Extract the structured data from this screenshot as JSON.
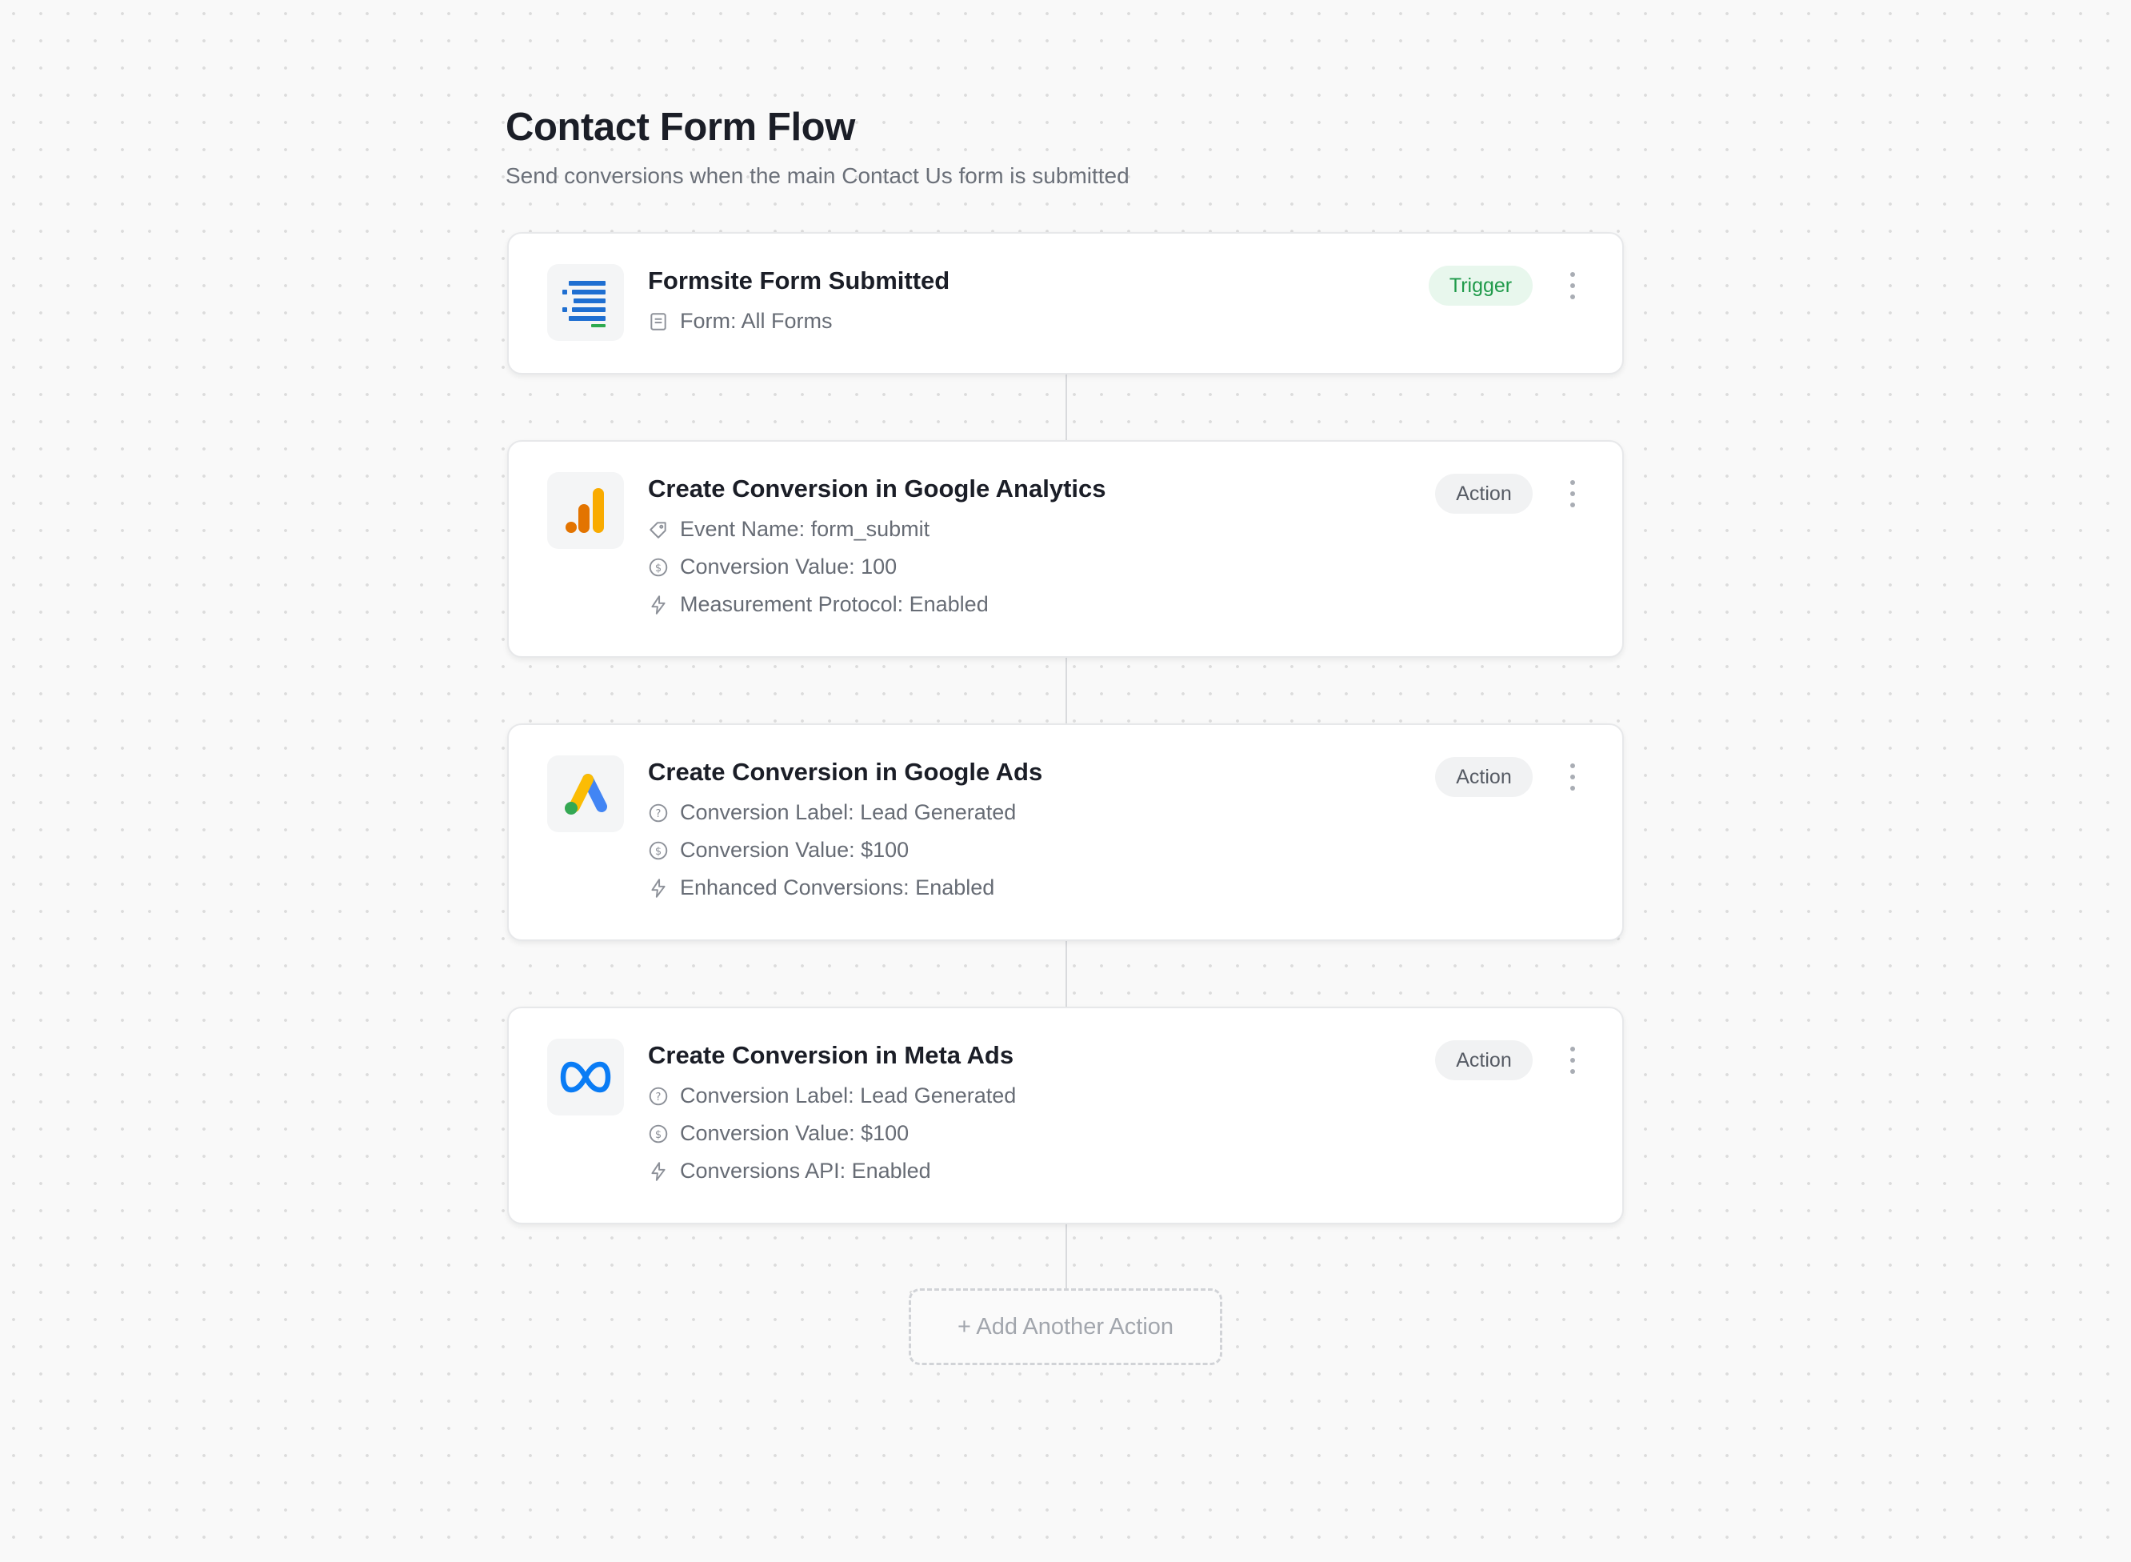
{
  "header": {
    "title": "Contact Form Flow",
    "subtitle": "Send conversions when the main Contact Us form is submitted"
  },
  "steps": [
    {
      "app": "Formsite",
      "title": "Formsite Form Submitted",
      "badge": "Trigger",
      "details": [
        {
          "icon": "form-icon",
          "text": "Form: All Forms"
        }
      ]
    },
    {
      "app": "Google Analytics",
      "title": "Create Conversion in Google Analytics",
      "badge": "Action",
      "details": [
        {
          "icon": "tag-icon",
          "text": "Event Name: form_submit"
        },
        {
          "icon": "dollar-icon",
          "text": "Conversion Value: 100"
        },
        {
          "icon": "bolt-icon",
          "text": "Measurement Protocol: Enabled"
        }
      ]
    },
    {
      "app": "Google Ads",
      "title": "Create Conversion in Google Ads",
      "badge": "Action",
      "details": [
        {
          "icon": "help-circle-icon",
          "text": "Conversion Label: Lead Generated"
        },
        {
          "icon": "dollar-icon",
          "text": "Conversion Value: $100"
        },
        {
          "icon": "bolt-icon",
          "text": "Enhanced Conversions: Enabled"
        }
      ]
    },
    {
      "app": "Meta Ads",
      "title": "Create Conversion in Meta Ads",
      "badge": "Action",
      "details": [
        {
          "icon": "help-circle-icon",
          "text": "Conversion Label: Lead Generated"
        },
        {
          "icon": "dollar-icon",
          "text": "Conversion Value: $100"
        },
        {
          "icon": "bolt-icon",
          "text": "Conversions API: Enabled"
        }
      ]
    }
  ],
  "add_action": {
    "label": "+ Add Another Action"
  },
  "colors": {
    "trigger_badge_bg": "#e8f7ed",
    "trigger_badge_text": "#1f9a4a",
    "action_badge_bg": "#f1f2f3",
    "formsite_blue": "#1f6fd1",
    "ga_orange": "#e37400",
    "ga_yellow": "#f9ab00",
    "ads_blue": "#4285f4",
    "ads_yellow": "#fbbc04",
    "ads_green": "#34a853",
    "meta_blue": "#0a7cf5"
  }
}
